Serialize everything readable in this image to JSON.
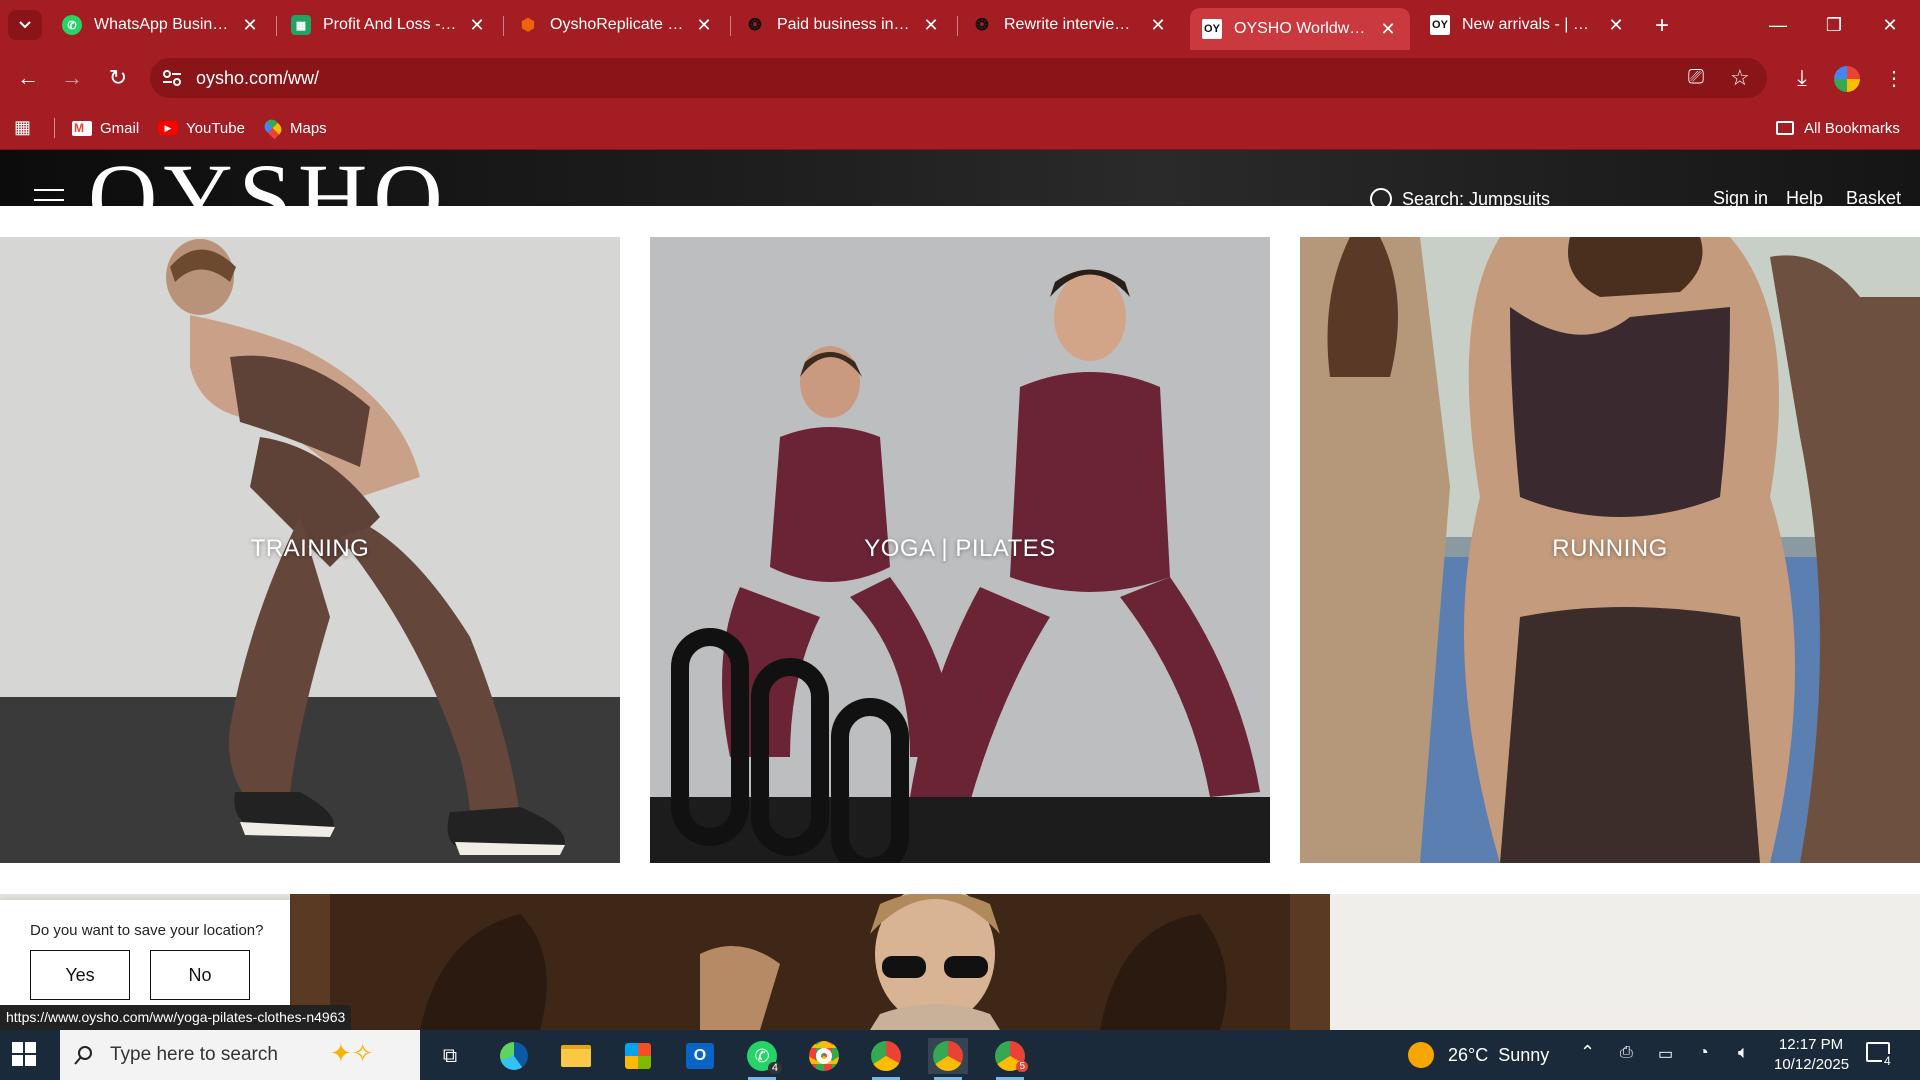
{
  "browser": {
    "tabs": [
      {
        "label": "WhatsApp Business",
        "icon": "whatsapp-icon"
      },
      {
        "label": "Profit And Loss - Goo",
        "icon": "sheets-icon"
      },
      {
        "label": "OyshoReplicate - Rep",
        "icon": "replit-icon"
      },
      {
        "label": "Paid business interns",
        "icon": "openai-icon"
      },
      {
        "label": "Rewrite interview foll",
        "icon": "openai-icon"
      },
      {
        "label": "OYSHO Worldwide |",
        "icon": "oysho-favicon"
      },
      {
        "label": "New arrivals - | OYSH",
        "icon": "oysho-favicon"
      }
    ],
    "favicon_text": "OY",
    "url": "oysho.com/ww/",
    "bookmarks": [
      {
        "label": "Gmail",
        "icon": "gmail-icon"
      },
      {
        "label": "YouTube",
        "icon": "youtube-icon"
      },
      {
        "label": "Maps",
        "icon": "maps-icon"
      }
    ],
    "all_bookmarks": "All Bookmarks",
    "accent": "#a31d22",
    "status_url": "https://www.oysho.com/ww/yoga-pilates-clothes-n4963"
  },
  "site": {
    "logo": "OYSHO",
    "search_label": "Search: Jumpsuits",
    "nav": {
      "sign_in": "Sign in",
      "help": "Help",
      "basket": "Basket"
    },
    "categories": [
      {
        "label": "TRAINING"
      },
      {
        "label": "YOGA | PILATES"
      },
      {
        "label": "RUNNING"
      }
    ],
    "location_prompt": {
      "question": "Do you want to save your location?",
      "yes": "Yes",
      "no": "No"
    }
  },
  "taskbar": {
    "search_placeholder": "Type here to search",
    "whatsapp_badge": "4",
    "chrome_badge": "5",
    "weather": "26°C  Sunny",
    "time": "12:17 PM",
    "date": "10/12/2025",
    "notification_count": "4"
  }
}
